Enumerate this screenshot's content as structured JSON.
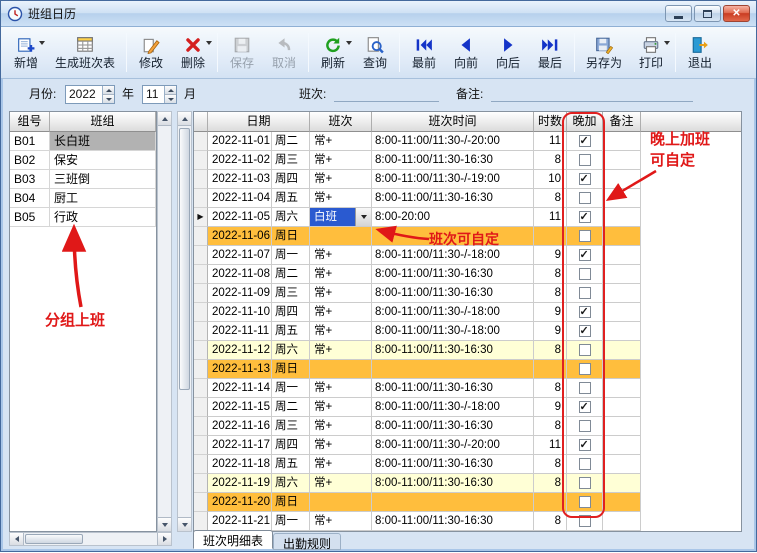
{
  "window": {
    "title": "班组日历"
  },
  "toolbar": {
    "items": [
      {
        "id": "new",
        "label": "新增",
        "dropdown": true,
        "enabled": true
      },
      {
        "id": "generate",
        "label": "生成班次表",
        "enabled": true
      },
      {
        "id": "modify",
        "label": "修改",
        "enabled": true
      },
      {
        "id": "delete",
        "label": "删除",
        "dropdown": true,
        "enabled": true
      },
      {
        "id": "save",
        "label": "保存",
        "enabled": false
      },
      {
        "id": "cancel",
        "label": "取消",
        "enabled": false
      },
      {
        "id": "refresh",
        "label": "刷新",
        "dropdown": true,
        "enabled": true
      },
      {
        "id": "query",
        "label": "查询",
        "enabled": true
      },
      {
        "id": "first",
        "label": "最前",
        "enabled": true
      },
      {
        "id": "prev",
        "label": "向前",
        "enabled": true
      },
      {
        "id": "next",
        "label": "向后",
        "enabled": true
      },
      {
        "id": "last",
        "label": "最后",
        "enabled": true
      },
      {
        "id": "saveas",
        "label": "另存为",
        "enabled": true
      },
      {
        "id": "print",
        "label": "打印",
        "dropdown": true,
        "enabled": true
      },
      {
        "id": "exit",
        "label": "退出",
        "enabled": true
      }
    ],
    "separators_after": [
      1,
      3,
      5,
      7,
      11,
      13
    ]
  },
  "filter": {
    "month_label": "月份:",
    "year": "2022",
    "year_unit": "年",
    "month": "11",
    "month_unit": "月",
    "shift_label": "班次:",
    "shift_value": "",
    "note_label": "备注:",
    "note_value": ""
  },
  "groups": {
    "columns": [
      "组号",
      "班组"
    ],
    "rows": [
      {
        "code": "B01",
        "name": "长白班",
        "selected": true
      },
      {
        "code": "B02",
        "name": "保安",
        "selected": false
      },
      {
        "code": "B03",
        "name": "三班倒",
        "selected": false
      },
      {
        "code": "B04",
        "name": "厨工",
        "selected": false
      },
      {
        "code": "B05",
        "name": "行政",
        "selected": false
      }
    ]
  },
  "calendar": {
    "columns": {
      "date": "日期",
      "shift": "班次",
      "time": "班次时间",
      "hours": "时数",
      "evening": "晚加",
      "note": "备注"
    },
    "rows": [
      {
        "date": "2022-11-01",
        "week": "周二",
        "shift": "常+",
        "time": "8:00-11:00/11:30-/-20:00",
        "hours": "11",
        "evening": true,
        "kind": "normal"
      },
      {
        "date": "2022-11-02",
        "week": "周三",
        "shift": "常+",
        "time": "8:00-11:00/11:30-16:30",
        "hours": "8",
        "evening": false,
        "kind": "normal"
      },
      {
        "date": "2022-11-03",
        "week": "周四",
        "shift": "常+",
        "time": "8:00-11:00/11:30-/-19:00",
        "hours": "10",
        "evening": true,
        "kind": "normal"
      },
      {
        "date": "2022-11-04",
        "week": "周五",
        "shift": "常+",
        "time": "8:00-11:00/11:30-16:30",
        "hours": "8",
        "evening": false,
        "kind": "normal"
      },
      {
        "date": "2022-11-05",
        "week": "周六",
        "shift": "白班",
        "time": "8:00-20:00",
        "hours": "11",
        "evening": true,
        "kind": "editing",
        "current": true
      },
      {
        "date": "2022-11-06",
        "week": "周日",
        "shift": "",
        "time": "",
        "hours": "",
        "evening": false,
        "kind": "sunday"
      },
      {
        "date": "2022-11-07",
        "week": "周一",
        "shift": "常+",
        "time": "8:00-11:00/11:30-/-18:00",
        "hours": "9",
        "evening": true,
        "kind": "normal"
      },
      {
        "date": "2022-11-08",
        "week": "周二",
        "shift": "常+",
        "time": "8:00-11:00/11:30-16:30",
        "hours": "8",
        "evening": false,
        "kind": "normal"
      },
      {
        "date": "2022-11-09",
        "week": "周三",
        "shift": "常+",
        "time": "8:00-11:00/11:30-16:30",
        "hours": "8",
        "evening": false,
        "kind": "normal"
      },
      {
        "date": "2022-11-10",
        "week": "周四",
        "shift": "常+",
        "time": "8:00-11:00/11:30-/-18:00",
        "hours": "9",
        "evening": true,
        "kind": "normal"
      },
      {
        "date": "2022-11-11",
        "week": "周五",
        "shift": "常+",
        "time": "8:00-11:00/11:30-/-18:00",
        "hours": "9",
        "evening": true,
        "kind": "normal"
      },
      {
        "date": "2022-11-12",
        "week": "周六",
        "shift": "常+",
        "time": "8:00-11:00/11:30-16:30",
        "hours": "8",
        "evening": false,
        "kind": "saturday"
      },
      {
        "date": "2022-11-13",
        "week": "周日",
        "shift": "",
        "time": "",
        "hours": "",
        "evening": false,
        "kind": "sunday"
      },
      {
        "date": "2022-11-14",
        "week": "周一",
        "shift": "常+",
        "time": "8:00-11:00/11:30-16:30",
        "hours": "8",
        "evening": false,
        "kind": "normal"
      },
      {
        "date": "2022-11-15",
        "week": "周二",
        "shift": "常+",
        "time": "8:00-11:00/11:30-/-18:00",
        "hours": "9",
        "evening": true,
        "kind": "normal"
      },
      {
        "date": "2022-11-16",
        "week": "周三",
        "shift": "常+",
        "time": "8:00-11:00/11:30-16:30",
        "hours": "8",
        "evening": false,
        "kind": "normal"
      },
      {
        "date": "2022-11-17",
        "week": "周四",
        "shift": "常+",
        "time": "8:00-11:00/11:30-/-20:00",
        "hours": "11",
        "evening": true,
        "kind": "normal"
      },
      {
        "date": "2022-11-18",
        "week": "周五",
        "shift": "常+",
        "time": "8:00-11:00/11:30-16:30",
        "hours": "8",
        "evening": false,
        "kind": "normal"
      },
      {
        "date": "2022-11-19",
        "week": "周六",
        "shift": "常+",
        "time": "8:00-11:00/11:30-16:30",
        "hours": "8",
        "evening": false,
        "kind": "saturday"
      },
      {
        "date": "2022-11-20",
        "week": "周日",
        "shift": "",
        "time": "",
        "hours": "",
        "evening": false,
        "kind": "sunday"
      },
      {
        "date": "2022-11-21",
        "week": "周一",
        "shift": "常+",
        "time": "8:00-11:00/11:30-16:30",
        "hours": "8",
        "evening": false,
        "kind": "normal"
      }
    ]
  },
  "tabs": {
    "items": [
      {
        "label": "班次明细表",
        "active": true
      },
      {
        "label": "出勤规则",
        "active": false
      }
    ]
  },
  "annotations": {
    "group": "分组上班",
    "shift": "班次可自定",
    "evening_line1": "晚上加班",
    "evening_line2": "可自定"
  },
  "colors": {
    "sunday_row": "#ffbe3d",
    "saturday_row": "#ffffd6",
    "annotation_red": "#e01818",
    "combobox_selection": "#2a5ad0",
    "group_selected": "#b2b2b2"
  }
}
